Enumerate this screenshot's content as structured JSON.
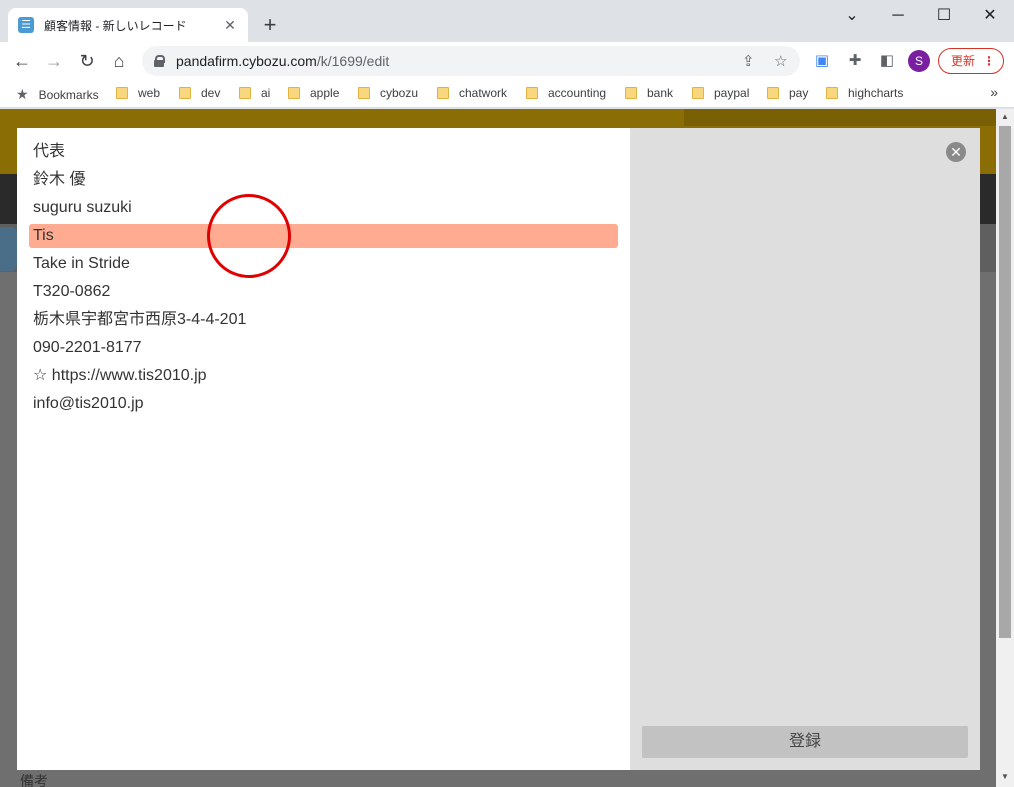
{
  "browser": {
    "tab_title": "顧客情報 - 新しいレコード",
    "tab_close": "✕",
    "new_tab": "+",
    "window_controls": {
      "minimize": "─",
      "maximize": "☐",
      "close": "✕",
      "tab_search": "⌄"
    },
    "url_host": "pandafirm.cybozu.com",
    "url_path": "/k/1699/edit",
    "avatar_letter": "S",
    "update_label": "更新",
    "update_menu": "⋮",
    "avatar_color": "#7b1fa2",
    "update_color": "#d93025"
  },
  "bookmarks": {
    "label": "Bookmarks",
    "folders": [
      "web",
      "dev",
      "ai",
      "apple",
      "cybozu",
      "chatwork",
      "accounting",
      "bank",
      "paypal",
      "pay",
      "highcharts"
    ],
    "more": "»"
  },
  "page": {
    "bottom_label": "備考"
  },
  "modal": {
    "items": [
      "代表",
      "鈴木 優",
      "suguru suzuki",
      "Tis",
      "Take in Stride",
      "T320-0862",
      "栃木県宇都宮市西原3-4-4-201",
      "090-2201-8177",
      "☆ https://www.tis2010.jp",
      "info@tis2010.jp"
    ],
    "selected_index": 3,
    "selected_color": "#ffab91",
    "close_glyph": "✕",
    "register_label": "登録"
  }
}
